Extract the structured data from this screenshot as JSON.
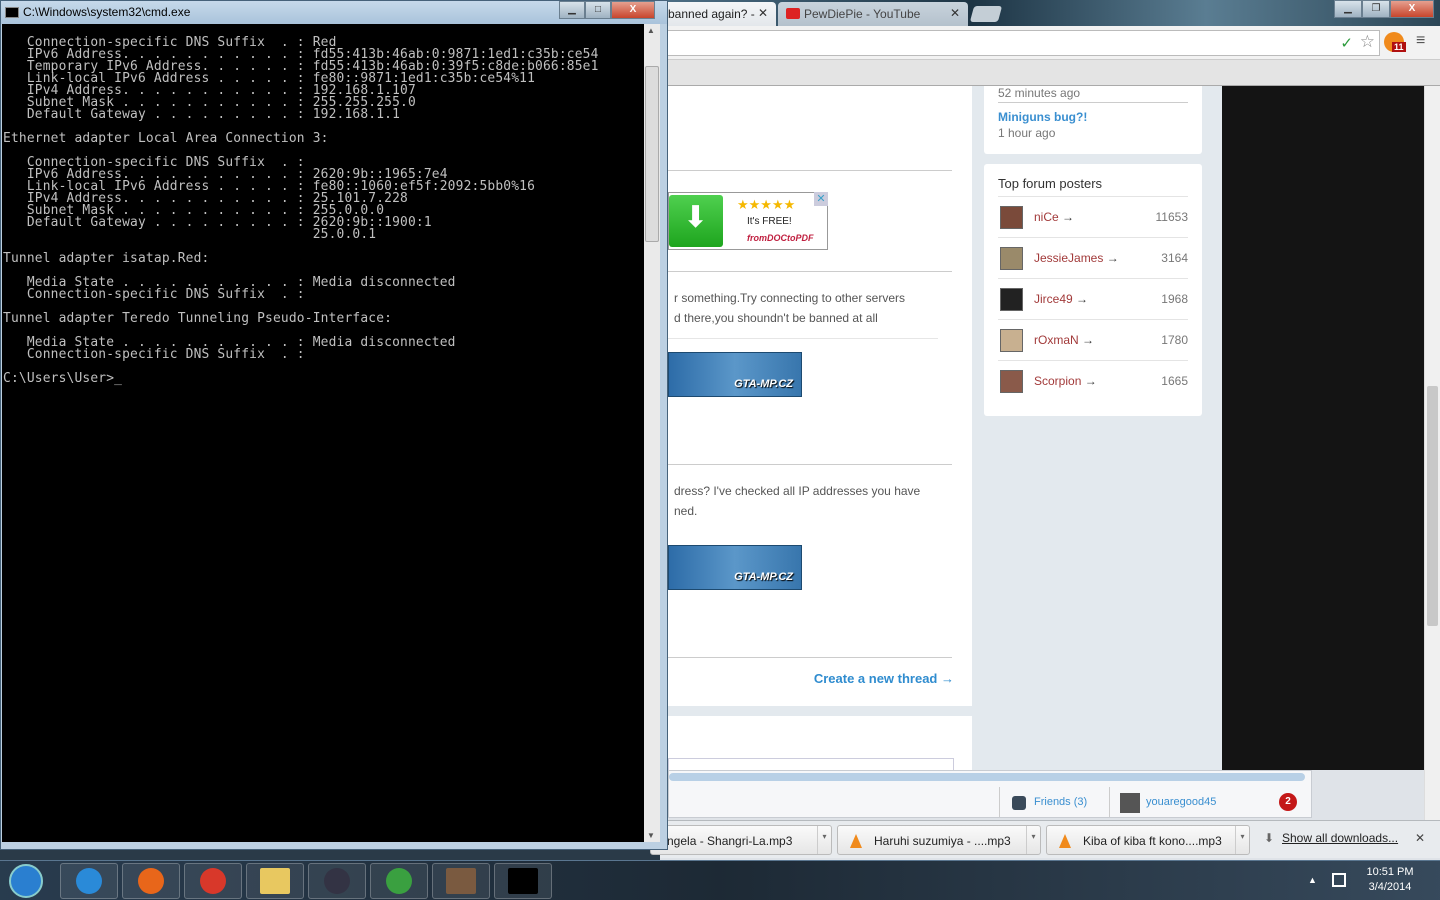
{
  "cmd": {
    "title": "C:\\Windows\\system32\\cmd.exe",
    "lines": [
      "   Connection-specific DNS Suffix  . : Red",
      "   IPv6 Address. . . . . . . . . . . : fd55:413b:46ab:0:9871:1ed1:c35b:ce54",
      "   Temporary IPv6 Address. . . . . . : fd55:413b:46ab:0:39f5:c8de:b066:85e1",
      "   Link-local IPv6 Address . . . . . : fe80::9871:1ed1:c35b:ce54%11",
      "   IPv4 Address. . . . . . . . . . . : 192.168.1.107",
      "   Subnet Mask . . . . . . . . . . . : 255.255.255.0",
      "   Default Gateway . . . . . . . . . : 192.168.1.1",
      "",
      "Ethernet adapter Local Area Connection 3:",
      "",
      "   Connection-specific DNS Suffix  . :",
      "   IPv6 Address. . . . . . . . . . . : 2620:9b::1965:7e4",
      "   Link-local IPv6 Address . . . . . : fe80::1060:ef5f:2092:5bb0%16",
      "   IPv4 Address. . . . . . . . . . . : 25.101.7.228",
      "   Subnet Mask . . . . . . . . . . . : 255.0.0.0",
      "   Default Gateway . . . . . . . . . : 2620:9b::1900:1",
      "                                       25.0.0.1",
      "",
      "Tunnel adapter isatap.Red:",
      "",
      "   Media State . . . . . . . . . . . : Media disconnected",
      "   Connection-specific DNS Suffix  . :",
      "",
      "Tunnel adapter Teredo Tunneling Pseudo-Interface:",
      "",
      "   Media State . . . . . . . . . . . : Media disconnected",
      "   Connection-specific DNS Suffix  . :",
      "",
      "C:\\Users\\User>_"
    ]
  },
  "browser": {
    "tabs": [
      {
        "label": "banned again? -"
      },
      {
        "label": "PewDiePie - YouTube"
      }
    ],
    "extension_badge": "11",
    "recent": {
      "time_prev": "52 minutes ago",
      "thread": "Miniguns bug?!",
      "time": "1 hour ago"
    },
    "top_posters": {
      "title": "Top forum posters",
      "items": [
        {
          "name": "niCe",
          "count": "11653"
        },
        {
          "name": "JessieJames",
          "count": "3164"
        },
        {
          "name": "Jirce49",
          "count": "1968"
        },
        {
          "name": "rOxmaN",
          "count": "1780"
        },
        {
          "name": "Scorpion",
          "count": "1665"
        }
      ]
    },
    "ad": {
      "text": "It's FREE!",
      "brand": "fromDOCtoPDF"
    },
    "posts": [
      {
        "line1": "r something.Try connecting to other servers",
        "line2": "d there,you shoundn't be banned at all",
        "banner": "GTA-MP.CZ"
      },
      {
        "line1": "dress? I've checked all IP addresses you have",
        "line2": "ned.",
        "banner": "GTA-MP.CZ"
      }
    ],
    "create_thread": "Create a new thread",
    "chat": {
      "friends": "Friends (3)",
      "user": "youaregood45",
      "notifications": "2"
    },
    "downloads": {
      "items": [
        "ngela - Shangri-La.mp3",
        "Haruhi suzumiya - ....mp3",
        "Kiba of kiba ft kono....mp3"
      ],
      "show_all": "Show all downloads..."
    }
  },
  "taskbar": {
    "time": "10:51 PM",
    "date": "3/4/2014",
    "apps": [
      "start",
      "internet-explorer",
      "firefox",
      "chrome",
      "file-explorer",
      "steam",
      "game-launcher",
      "gta-avatar",
      "cmd"
    ]
  }
}
